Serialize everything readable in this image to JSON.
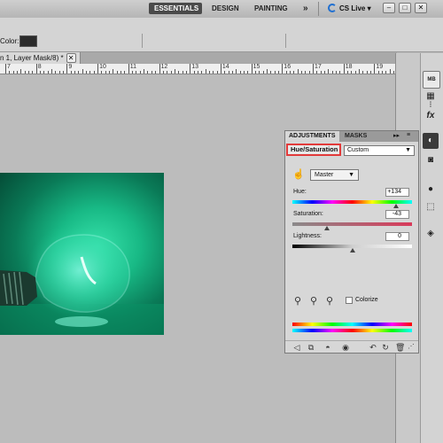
{
  "workspace": {
    "buttons": [
      "ESSENTIALS",
      "DESIGN",
      "PAINTING"
    ],
    "more": "»",
    "cs_live": "CS Live ▾",
    "window_controls": [
      "–",
      "□",
      "✕"
    ]
  },
  "options_bar": {
    "color_label": "Color:",
    "color_swatch": "#2b2b2b"
  },
  "document_tab": {
    "title": "n 1, Layer Mask/8) *",
    "close": "✕"
  },
  "ruler": {
    "numbers": [
      "7",
      "8",
      "9",
      "10",
      "11",
      "12",
      "13",
      "14",
      "15",
      "16",
      "17",
      "18",
      "19"
    ]
  },
  "photo": {
    "subject": "green light bulb"
  },
  "dock_icons": [
    "mini-bridge-icon",
    "swatches-icon",
    "brush-presets-icon",
    "character-icon",
    "adjustments-icon",
    "masks-icon",
    "styles-icon",
    "paths-icon",
    "layers-icon"
  ],
  "adjustments_panel": {
    "tabs": [
      "ADJUSTMENTS",
      "MASKS"
    ],
    "collapse": "▸▸",
    "menu": "≡",
    "title": "Hue/Saturation",
    "preset": "Custom",
    "channel": "Master",
    "hue": {
      "label": "Hue:",
      "value": "+134",
      "position": 0.87
    },
    "saturation": {
      "label": "Saturation:",
      "value": "-43",
      "position": 0.29
    },
    "lightness": {
      "label": "Lightness:",
      "value": "0",
      "position": 0.5
    },
    "colorize": {
      "label": "Colorize",
      "checked": false
    },
    "highlight_color": "#e23a3a"
  }
}
